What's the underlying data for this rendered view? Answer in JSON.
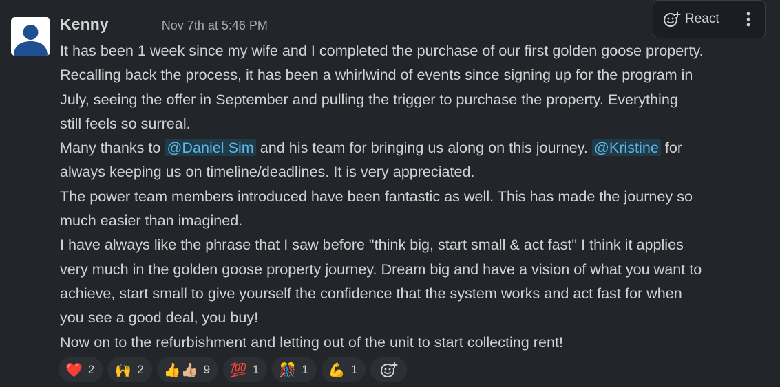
{
  "message": {
    "author": "Kenny",
    "timestamp": "Nov 7th at 5:46 PM",
    "lines": {
      "l1": "It has been 1 week since my wife and I completed the purchase of our first golden goose property.",
      "l2": "Recalling back the process, it has been a whirlwind of events since signing up for the program in",
      "l3": "July, seeing the offer in September and pulling the trigger to purchase the property. Everything",
      "l4": "still feels so surreal.",
      "l5_pre": "Many thanks to ",
      "l5_mention1": "@Daniel Sim",
      "l5_mid": " and his team for bringing us along on this journey. ",
      "l5_mention2": "@Kristine",
      "l5_post": " for",
      "l6": "always keeping us on timeline/deadlines. It is very appreciated.",
      "l7": "The power team members introduced have been fantastic as well. This has made the journey so",
      "l8": "much easier than imagined.",
      "l9": "I have always like the phrase that I saw before \"think big, start small & act fast\" I think it applies",
      "l10": "very much in the golden goose property journey. Dream big and have a vision of what you want to",
      "l11": "achieve, start small to give yourself the confidence that the system works and act fast for when",
      "l12": "you see a good deal, you buy!",
      "l13": "Now on to the refurbishment and letting out of the unit to start collecting rent!"
    }
  },
  "actions": {
    "react_label": "React",
    "react_icon": "add-emoji-icon",
    "more_icon": "more-vertical-icon"
  },
  "reactions": [
    {
      "emoji": "❤️",
      "name": "heart",
      "count": "2"
    },
    {
      "emoji": "🙌",
      "name": "raised-hands",
      "count": "2"
    },
    {
      "emoji": "👍👍🏼",
      "name": "thumbs-up",
      "count": "9"
    },
    {
      "emoji": "💯",
      "name": "hundred",
      "count": "1"
    },
    {
      "emoji": "🎊",
      "name": "confetti",
      "count": "1"
    },
    {
      "emoji": "💪",
      "name": "flexed-biceps",
      "count": "1"
    }
  ],
  "colors": {
    "background": "#222529",
    "text": "#d1d2d3",
    "timestamp": "#ababad",
    "mention_text": "#5cb6e8",
    "avatar_fill": "#1d4f91"
  }
}
